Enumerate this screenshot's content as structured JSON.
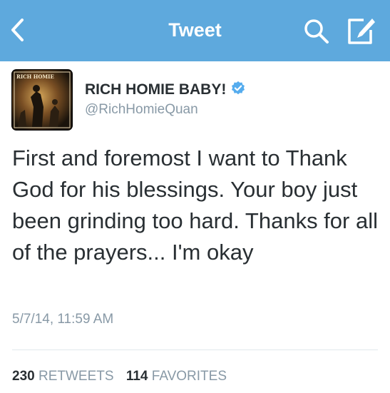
{
  "nav": {
    "title": "Tweet",
    "back_icon": "chevron-left-icon",
    "search_icon": "search-icon",
    "compose_icon": "compose-icon",
    "bar_color": "#5ea9dd"
  },
  "tweet": {
    "display_name": "RICH HOMIE BABY!",
    "verified": true,
    "handle": "@RichHomieQuan",
    "avatar_text": "RICH HOMIE",
    "text": "First and foremost I want to Thank God for his blessings. Your boy just been grinding too hard. Thanks for all of the prayers... I'm okay",
    "timestamp": "5/7/14, 11:59 AM"
  },
  "stats": {
    "retweets_count": "230",
    "retweets_label": "RETWEETS",
    "favorites_count": "114",
    "favorites_label": "FAVORITES"
  }
}
